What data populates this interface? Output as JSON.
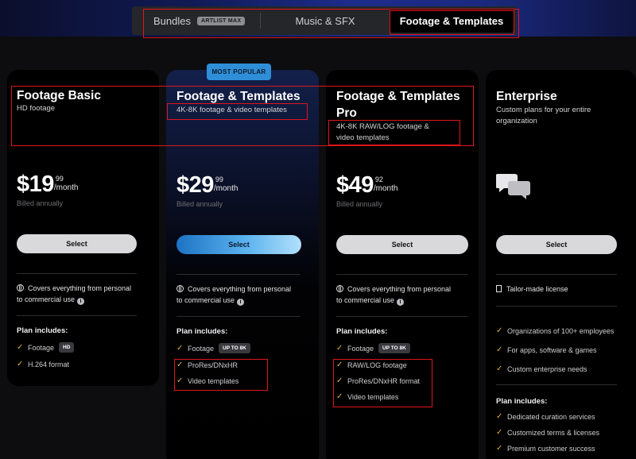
{
  "tabs": [
    {
      "label": "Bundles",
      "badge": "ARTLIST MAX"
    },
    {
      "label": "Music & SFX"
    },
    {
      "label": "Footage & Templates"
    }
  ],
  "popular_badge": "MOST POPULAR",
  "cards": [
    {
      "title": "Footage Basic",
      "subtitle": "HD footage",
      "price_main": "$19",
      "price_cents": "99",
      "price_per": "/month",
      "billed": "Billed annually",
      "button": "Select",
      "cover_line1": "Covers everything from personal",
      "cover_line2": "to commercial use",
      "plan_header": "Plan includes:",
      "features": [
        {
          "text": "Footage",
          "pill": "HD"
        },
        {
          "text": "H.264 format"
        }
      ]
    },
    {
      "title": "Footage & Templates",
      "subtitle": "4K-8K footage & video templates",
      "price_main": "$29",
      "price_cents": "99",
      "price_per": "/month",
      "billed": "Billed annually",
      "button": "Select",
      "cover_line1": "Covers everything from personal",
      "cover_line2": "to commercial use",
      "plan_header": "Plan includes:",
      "features": [
        {
          "text": "Footage",
          "pill": "UP TO 8K"
        },
        {
          "text": "ProRes/DNxHR"
        },
        {
          "text": "Video templates"
        }
      ]
    },
    {
      "title_line1": "Footage & Templates",
      "title_line2": "Pro",
      "subtitle_line1": "4K-8K RAW/LOG footage &",
      "subtitle_line2": "video templates",
      "price_main": "$49",
      "price_cents": "92",
      "price_per": "/month",
      "billed": "Billed annually",
      "button": "Select",
      "cover_line1": "Covers everything from personal",
      "cover_line2": "to commercial use",
      "plan_header": "Plan includes:",
      "features": [
        {
          "text": "Footage",
          "pill": "UP TO 8K"
        },
        {
          "text": "RAW/LOG footage"
        },
        {
          "text": "ProRes/DNxHR format"
        },
        {
          "text": "Video templates"
        }
      ]
    },
    {
      "title": "Enterprise",
      "subtitle_line1": "Custom plans for your entire",
      "subtitle_line2": "organization",
      "button": "Select",
      "license": "Tailor-made license",
      "top_features": [
        "Organizations of 100+ employees",
        "For apps, software & games",
        "Custom enterprise needs"
      ],
      "plan_header": "Plan includes:",
      "features": [
        "Dedicated curation services",
        "Customized terms & licenses",
        "Premium customer success"
      ]
    }
  ],
  "icons": {
    "check": "check-icon",
    "globe": "globe-icon",
    "info": "info-icon",
    "chat": "chat-bubbles-icon",
    "building": "building-icon"
  },
  "colors": {
    "accent_gold": "#e0b13c",
    "popular_blue": "#2e8fd8",
    "highlight_red": "#e0141c"
  }
}
